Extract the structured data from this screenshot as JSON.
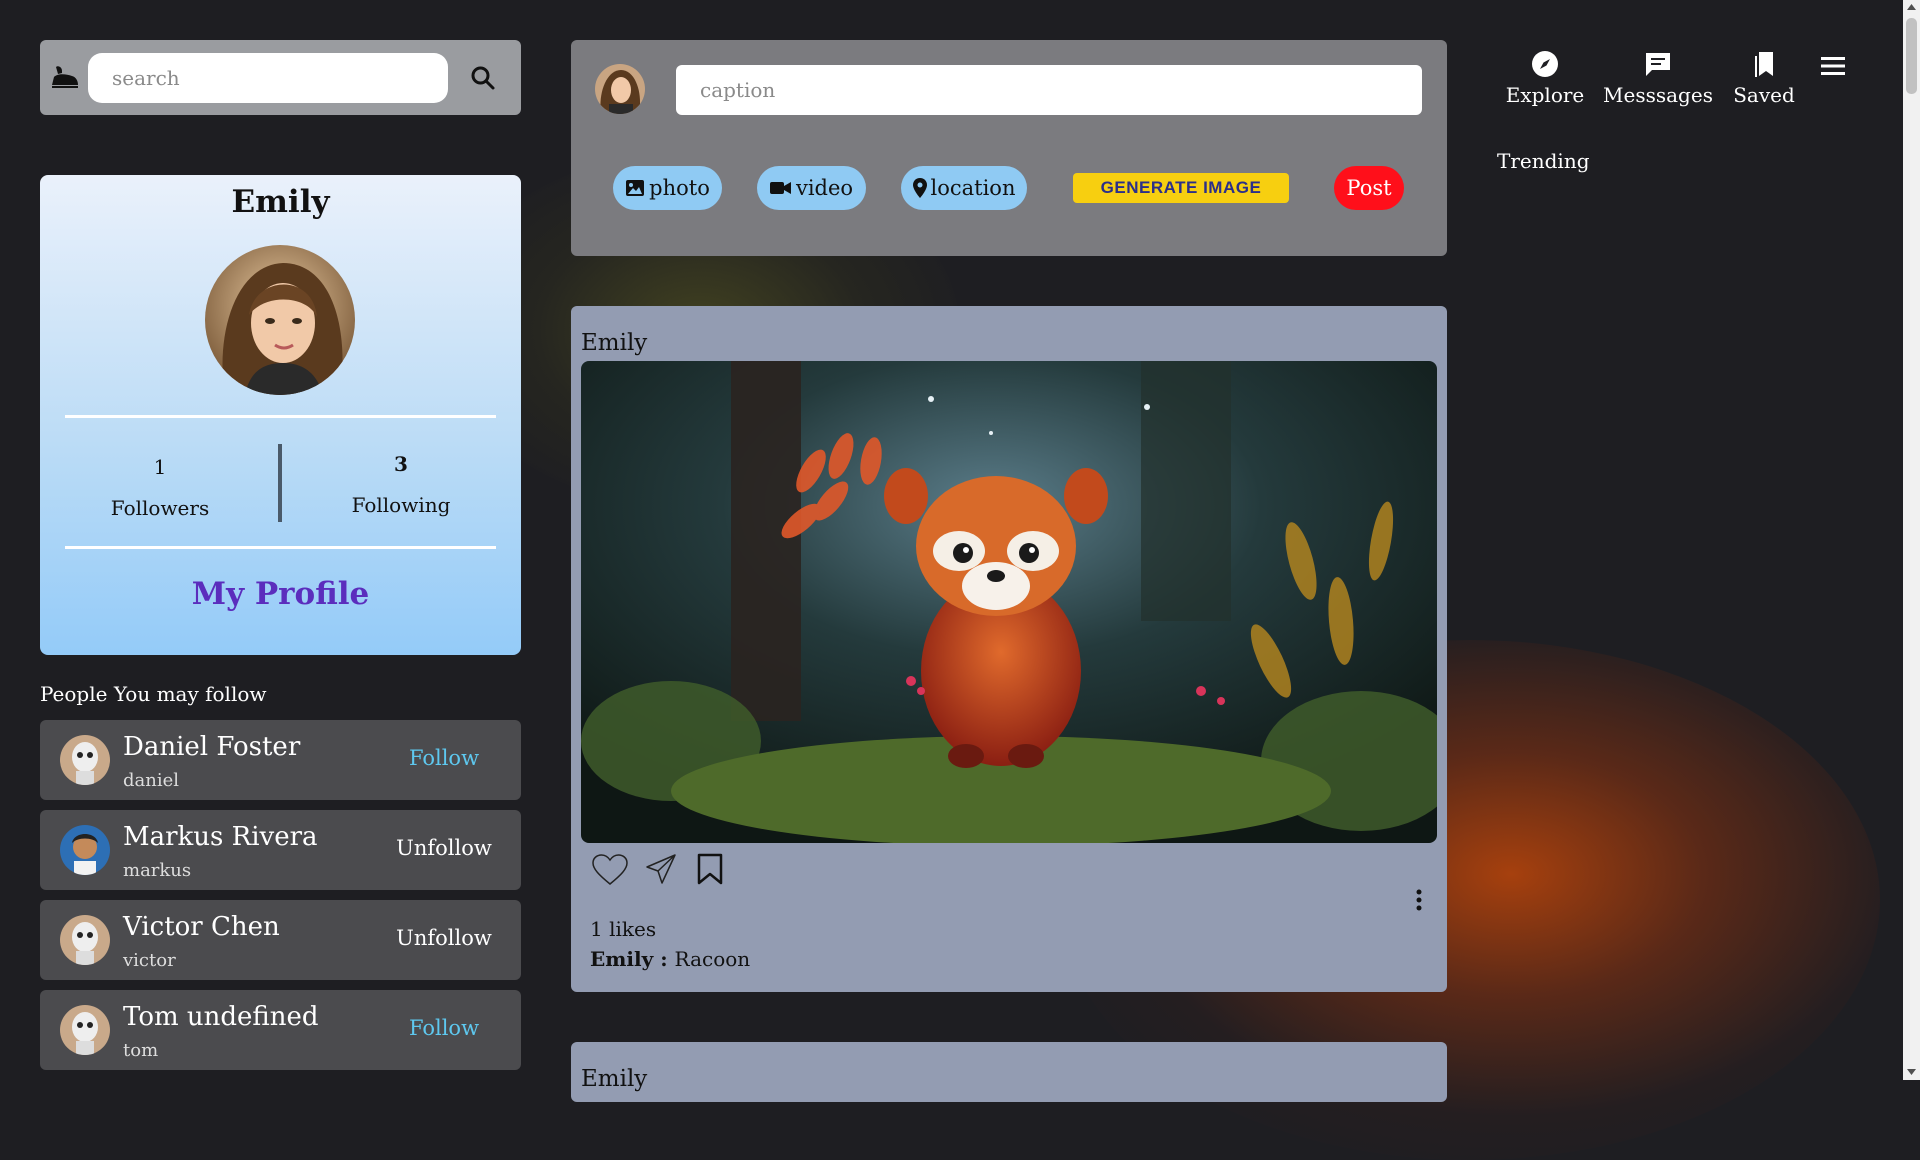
{
  "search": {
    "placeholder": "search"
  },
  "profile": {
    "name": "Emily",
    "followers_count": "1",
    "followers_label": "Followers",
    "following_count": "3",
    "following_label": "Following",
    "my_profile_label": "My Profile"
  },
  "people": {
    "title": "People You may follow",
    "items": [
      {
        "name": "Daniel Foster",
        "username": "daniel",
        "action": "Follow",
        "avatar": "robot-avatar"
      },
      {
        "name": "Markus Rivera",
        "username": "markus",
        "action": "Unfollow",
        "avatar": "person-avatar"
      },
      {
        "name": "Victor Chen",
        "username": "victor",
        "action": "Unfollow",
        "avatar": "robot-avatar"
      },
      {
        "name": "Tom undefined",
        "username": "tom",
        "action": "Follow",
        "avatar": "robot-avatar"
      }
    ]
  },
  "composer": {
    "caption_placeholder": "caption",
    "photo_label": "photo",
    "video_label": "video",
    "location_label": "location",
    "generate_label": "GENERATE IMAGE",
    "post_label": "Post"
  },
  "nav": {
    "explore": "Explore",
    "messages": "Messsages",
    "saved": "Saved",
    "trending": "Trending"
  },
  "feed": [
    {
      "author": "Emily",
      "likes": "1 likes",
      "caption_author": "Emily",
      "caption_sep": " : ",
      "caption_text": "Racoon"
    },
    {
      "author": "Emily"
    }
  ],
  "colors": {
    "follow": "#5ec8ef",
    "unfollow": "#ffffff",
    "post_button": "#ff0f1a",
    "generate_button": "#f7cf10",
    "pill": "#8fcaf3",
    "my_profile": "#5b2dbd"
  }
}
